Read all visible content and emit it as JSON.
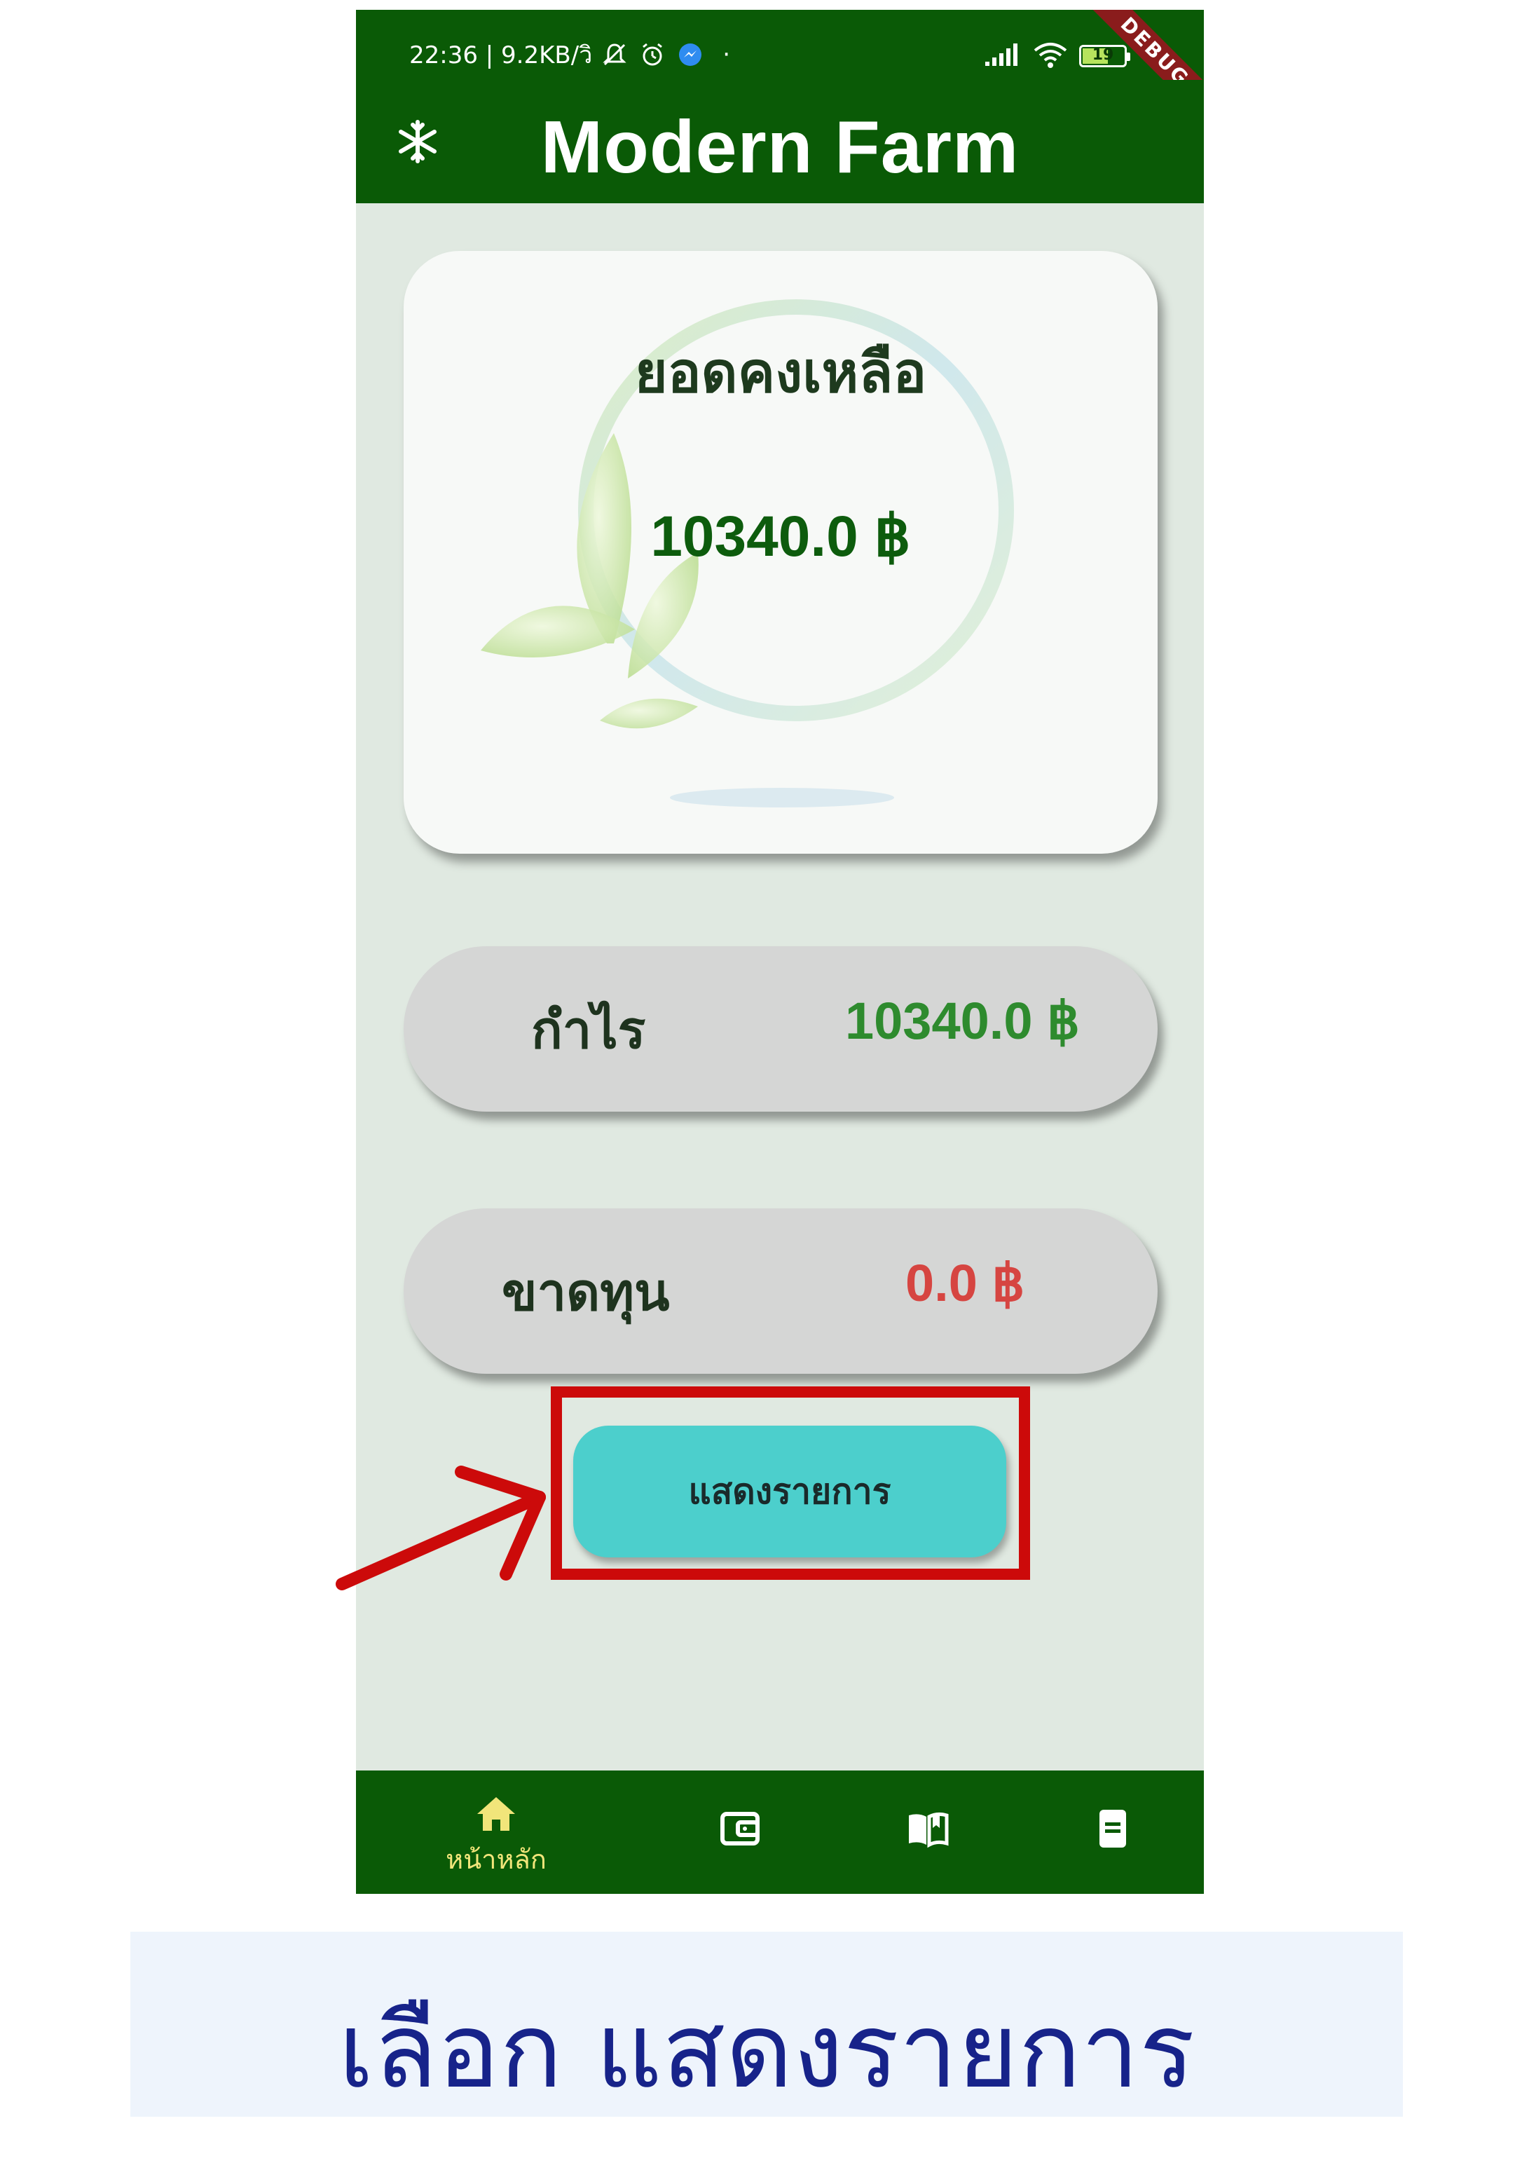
{
  "status_bar": {
    "time_info": "22:36 | 9.2KB/วิ",
    "battery": "19",
    "debug": "DEBUG"
  },
  "app": {
    "title": "Modern Farm"
  },
  "balance": {
    "title": "ยอดคงเหลือ",
    "amount": "10340.0 ฿"
  },
  "profit": {
    "label": "กำไร",
    "value": "10340.0 ฿",
    "color": "#2e8b2e"
  },
  "loss": {
    "label": "ขาดทุน",
    "value": "0.0 ฿",
    "color": "#d64541"
  },
  "show_list_button": {
    "label": "แสดงรายการ",
    "color": "#4ccfcc"
  },
  "bottom_nav": {
    "items": [
      {
        "icon": "home-icon",
        "label": "หน้าหลัก",
        "active": true
      },
      {
        "icon": "wallet-icon",
        "label": "",
        "active": false
      },
      {
        "icon": "book-icon",
        "label": "",
        "active": false
      },
      {
        "icon": "document-icon",
        "label": "",
        "active": false
      }
    ],
    "active_color": "#f1e57a"
  },
  "annotation": {
    "highlight_color": "#cc0a0a"
  },
  "caption": {
    "text": "เลือก แสดงรายการ"
  },
  "colors": {
    "brand_green": "#0a5a06",
    "background": "#e0e9e1"
  }
}
